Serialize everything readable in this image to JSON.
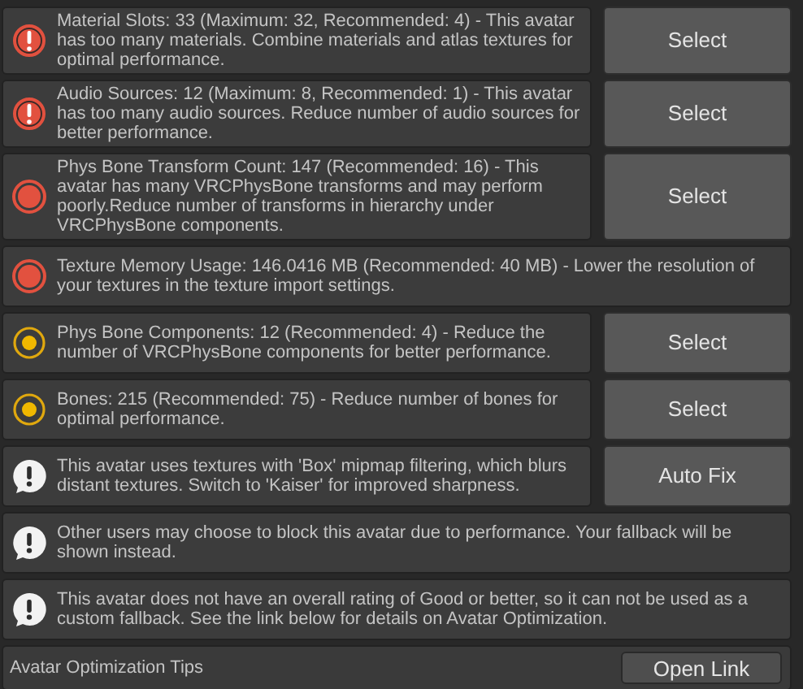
{
  "messages": [
    {
      "kind": "error",
      "text": "Material Slots: 33 (Maximum: 32, Recommended: 4) - This avatar has too many materials. Combine materials and atlas textures for optimal performance.",
      "button": "Select"
    },
    {
      "kind": "error",
      "text": "Audio Sources: 12 (Maximum: 8, Recommended: 1) - This avatar has too many audio sources. Reduce number of audio sources for better performance.",
      "button": "Select"
    },
    {
      "kind": "poor",
      "text": "Phys Bone Transform Count: 147 (Recommended: 16) - This avatar has many VRCPhysBone transforms and may perform poorly.Reduce number of transforms in hierarchy under VRCPhysBone components.",
      "button": "Select"
    },
    {
      "kind": "poor",
      "text": "Texture Memory Usage: 146.0416 MB (Recommended: 40 MB) - Lower the resolution of your textures in the texture import settings."
    },
    {
      "kind": "medium",
      "text": "Phys Bone Components: 12 (Recommended: 4) - Reduce the number of VRCPhysBone components for better performance.",
      "button": "Select"
    },
    {
      "kind": "medium",
      "text": "Bones: 215 (Recommended: 75) - Reduce number of bones for optimal performance.",
      "button": "Select"
    },
    {
      "kind": "info",
      "text": "This avatar uses textures with 'Box' mipmap filtering, which blurs distant textures. Switch to 'Kaiser' for improved sharpness.",
      "button": "Auto Fix"
    },
    {
      "kind": "info",
      "text": "Other users may choose to block this avatar due to performance. Your fallback will be shown instead."
    },
    {
      "kind": "info",
      "text": "This avatar does not have an overall rating of Good or better, so it can not be used as a custom fallback. See the link below for details on Avatar Optimization."
    }
  ],
  "footer": {
    "label": "Avatar Optimization Tips",
    "button": "Open Link"
  }
}
